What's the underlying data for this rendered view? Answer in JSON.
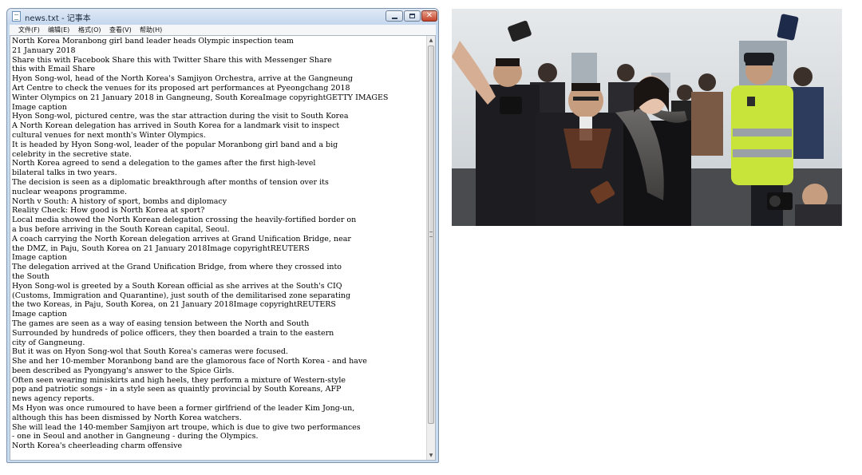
{
  "window": {
    "title": "news.txt - 记事本",
    "buttons": {
      "minimize": "",
      "maximize": "",
      "close": "✕"
    }
  },
  "menu": [
    "文件(F)",
    "编辑(E)",
    "格式(O)",
    "查看(V)",
    "帮助(H)"
  ],
  "document": {
    "lines": [
      "North Korea Moranbong girl band leader heads Olympic inspection team",
      "21 January 2018",
      "Share this with Facebook  Share this with Twitter  Share this with Messenger  Share",
      "this with Email  Share",
      "Hyon Song-wol, head of the North Korea's Samjiyon Orchestra, arrive at the Gangneung",
      "Art Centre to check the venues for its proposed art performances at Pyeongchang 2018",
      "Winter Olympics on 21 January 2018 in Gangneung, South KoreaImage copyrightGETTY IMAGES",
      "Image caption",
      "Hyon Song-wol, pictured centre, was the star attraction during the visit to South Korea",
      "A North Korean delegation has arrived in South Korea for a landmark visit to inspect",
      "cultural venues for next month's Winter Olympics.",
      "It is headed by Hyon Song-wol, leader of the popular Moranbong girl band and a big",
      "celebrity in the secretive state.",
      "North Korea agreed to send a delegation to the games after the first high-level",
      "bilateral talks in two years.",
      "The decision is seen as a diplomatic breakthrough after months of tension over its",
      "nuclear weapons programme.",
      "North v South: A history of sport, bombs and diplomacy",
      "Reality Check: How good is North Korea at sport?",
      "Local media showed the North Korean delegation crossing the heavily-fortified border on",
      "a bus before arriving in the South Korean capital, Seoul.",
      "A coach carrying the North Korean delegation arrives at Grand Unification Bridge, near",
      "the DMZ, in Paju, South Korea on 21 January 2018Image copyrightREUTERS",
      "Image caption",
      "The delegation arrived at the Grand Unification Bridge, from where they crossed into",
      "the South",
      "Hyon Song-wol is greeted by a South Korean official as she arrives at the South's CIQ",
      "(Customs, Immigration and Quarantine), just south of the demilitarised zone separating",
      "the two Koreas, in Paju, South Korea, on 21 January 2018Image copyrightREUTERS",
      "Image caption",
      "The games are seen as a way of easing tension between the North and South",
      "Surrounded by hundreds of police officers, they then boarded a train to the eastern",
      "city of Gangneung.",
      "But it was on Hyon Song-wol that South Korea's cameras were focused.",
      "She and her 10-member Moranbong band are the glamorous face of North Korea - and have",
      "been described as Pyongyang's answer to the Spice Girls.",
      "Often seen wearing miniskirts and high heels, they perform a mixture of Western-style",
      "pop and patriotic songs - in a style seen as quaintly provincial by South Koreans, AFP",
      "news agency reports.",
      "Ms Hyon was once rumoured to have been a former girlfriend of the leader Kim Jong-un,",
      "although this has been dismissed by North Korea watchers.",
      "She will lead the 140-member Samjiyon art troupe, which is due to give two performances",
      "- one in Seoul and another in Gangneung - during the Olympics.",
      "North Korea's cheerleading charm offensive"
    ]
  },
  "scrollbar": {
    "up": "▲",
    "down": "▼"
  },
  "colors": {
    "police_vest": "#c8e33a",
    "coat_dark": "#1f1e22",
    "sky": "#d9dde0"
  }
}
